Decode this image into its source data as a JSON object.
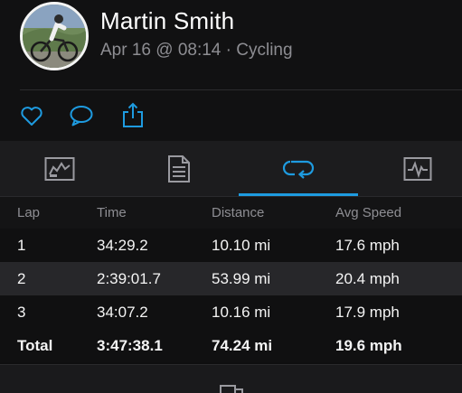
{
  "activity": {
    "athlete_name": "Martin Smith",
    "meta": "Apr 16 @ 08:14 · Cycling"
  },
  "actions": [
    {
      "icon": "heart-icon"
    },
    {
      "icon": "comment-icon"
    },
    {
      "icon": "share-icon"
    }
  ],
  "tabs": [
    {
      "icon": "chart-card-icon"
    },
    {
      "icon": "document-icon"
    },
    {
      "icon": "laps-loop-icon",
      "selected": true
    },
    {
      "icon": "activity-graph-icon"
    }
  ],
  "colors": {
    "accent": "#1e9be0",
    "background": "#0f0f10",
    "muted_text": "#8d8d92"
  },
  "laps_table": {
    "headers": [
      "Lap",
      "Time",
      "Distance",
      "Avg Speed"
    ],
    "rows": [
      [
        "1",
        "34:29.2",
        "10.10 mi",
        "17.6 mph"
      ],
      [
        "2",
        "2:39:01.7",
        "53.99 mi",
        "20.4 mph"
      ],
      [
        "3",
        "34:07.2",
        "10.16 mi",
        "17.9 mph"
      ]
    ],
    "total": [
      "Total",
      "3:47:38.1",
      "74.24 mi",
      "19.6 mph"
    ]
  },
  "bottom_bar": {
    "icon": "device-icon"
  }
}
